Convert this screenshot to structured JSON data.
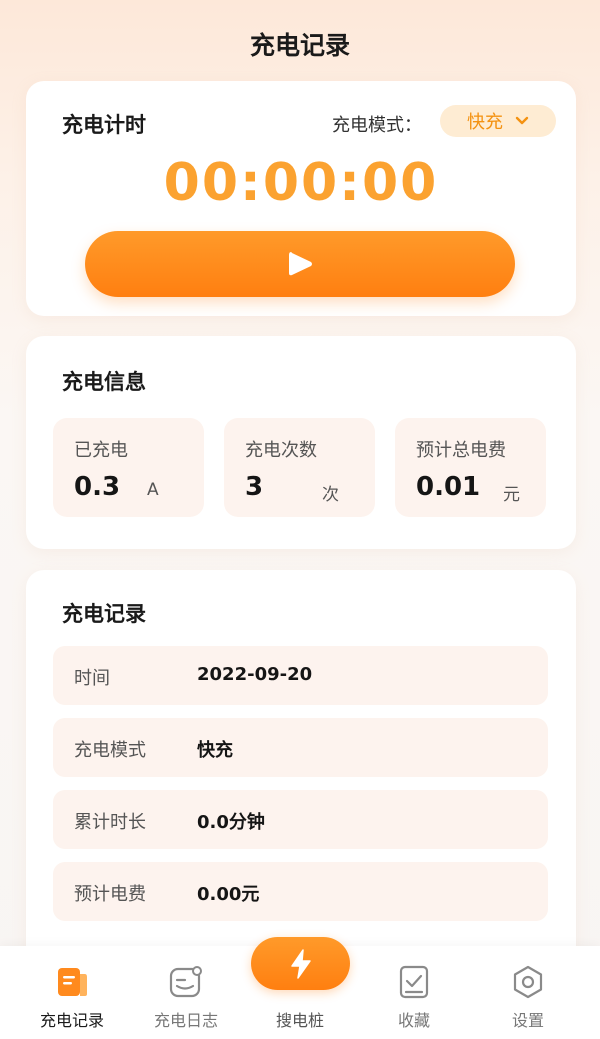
{
  "page": {
    "title": "充电记录"
  },
  "timer": {
    "title": "充电计时",
    "mode_label": "充电模式：",
    "mode_value": "快充",
    "display": "00:00:00",
    "start_icon": "play-icon"
  },
  "info": {
    "title": "充电信息",
    "stats": [
      {
        "label": "已充电",
        "value": "0.3",
        "unit": "A"
      },
      {
        "label": "充电次数",
        "value": "3",
        "unit": "次"
      },
      {
        "label": "预计总电费",
        "value": "0.01",
        "unit": "元"
      }
    ]
  },
  "records": {
    "title": "充电记录",
    "rows": [
      {
        "label": "时间",
        "value": "2022-09-20"
      },
      {
        "label": "充电模式",
        "value": "快充"
      },
      {
        "label": "累计时长",
        "value": "0.0分钟"
      },
      {
        "label": "预计电费",
        "value": "0.00元"
      }
    ]
  },
  "nav": {
    "items": [
      {
        "label": "充电记录",
        "icon": "charge-record-icon",
        "active": true
      },
      {
        "label": "充电日志",
        "icon": "charge-log-icon",
        "active": false
      },
      {
        "label": "搜电桩",
        "icon": "lightning-icon",
        "active": false
      },
      {
        "label": "收藏",
        "icon": "favorite-icon",
        "active": false
      },
      {
        "label": "设置",
        "icon": "settings-icon",
        "active": false
      }
    ]
  },
  "colors": {
    "accent": "#ff8a1e",
    "timer_digits": "#fba230",
    "mode_pill_bg": "#feecd3",
    "card_inner_bg": "#fdf3ee"
  }
}
